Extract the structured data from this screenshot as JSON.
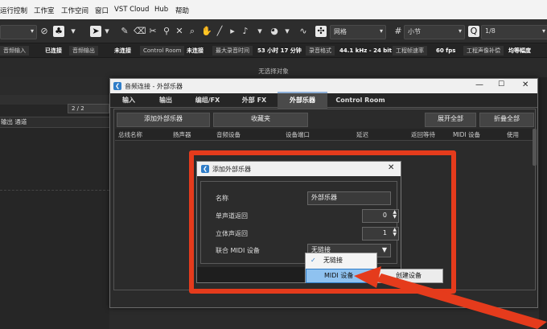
{
  "menubar": {
    "items": [
      "运行控制",
      "工作室",
      "工作空间",
      "窗口",
      "VST Cloud",
      "Hub",
      "帮助"
    ]
  },
  "toolbar": {
    "grid_label": "网格",
    "snap_label": "小节",
    "quantize_label": "1/8"
  },
  "statusbar": {
    "items": [
      {
        "label": "音频输入",
        "value": "已连接"
      },
      {
        "label": "音频输出",
        "value": "未连接"
      },
      {
        "label": "Control Room",
        "value": "未连接"
      },
      {
        "label": "最大录音时间",
        "value": "53 小时 17 分钟"
      },
      {
        "label": "录音格式",
        "value": "44.1 kHz - 24 bit"
      },
      {
        "label": "工程帧速率",
        "value": "60 fps"
      },
      {
        "label": "工程声像补偿",
        "value": "均等幅度"
      }
    ]
  },
  "no_selection": "无选择对象",
  "left_panel": {
    "counter": "2 / 2",
    "track_label": "输出 通道"
  },
  "dialog": {
    "title": "音频连接 - 外部乐器",
    "tabs": [
      "输入",
      "输出",
      "编组/FX",
      "外部 FX",
      "外部乐器",
      "Control Room"
    ],
    "active_tab": "外部乐器",
    "add_button": "添加外部乐器",
    "favorites_button": "收藏夹",
    "expand_all": "展开全部",
    "collapse_all": "折叠全部",
    "columns": [
      "总线名称",
      "扬声器",
      "音频设备",
      "设备端口",
      "延迟",
      "返回等待",
      "MIDI 设备",
      "使用"
    ]
  },
  "subdialog": {
    "title": "添加外部乐器",
    "name_label": "名称",
    "name_value": "外部乐器",
    "mono_label": "单声道返回",
    "mono_value": "0",
    "stereo_label": "立体声返回",
    "stereo_value": "1",
    "midi_label": "联合 MIDI 设备",
    "midi_value": "无链接"
  },
  "midi_dropdown": {
    "options": [
      "无链接",
      "MIDI 设备"
    ],
    "checked": "无链接",
    "highlighted": "MIDI 设备"
  },
  "popup": {
    "label": "创建设备"
  },
  "colors": {
    "highlight_red": "#e53b1c",
    "accent_blue": "#2f7dc8"
  }
}
